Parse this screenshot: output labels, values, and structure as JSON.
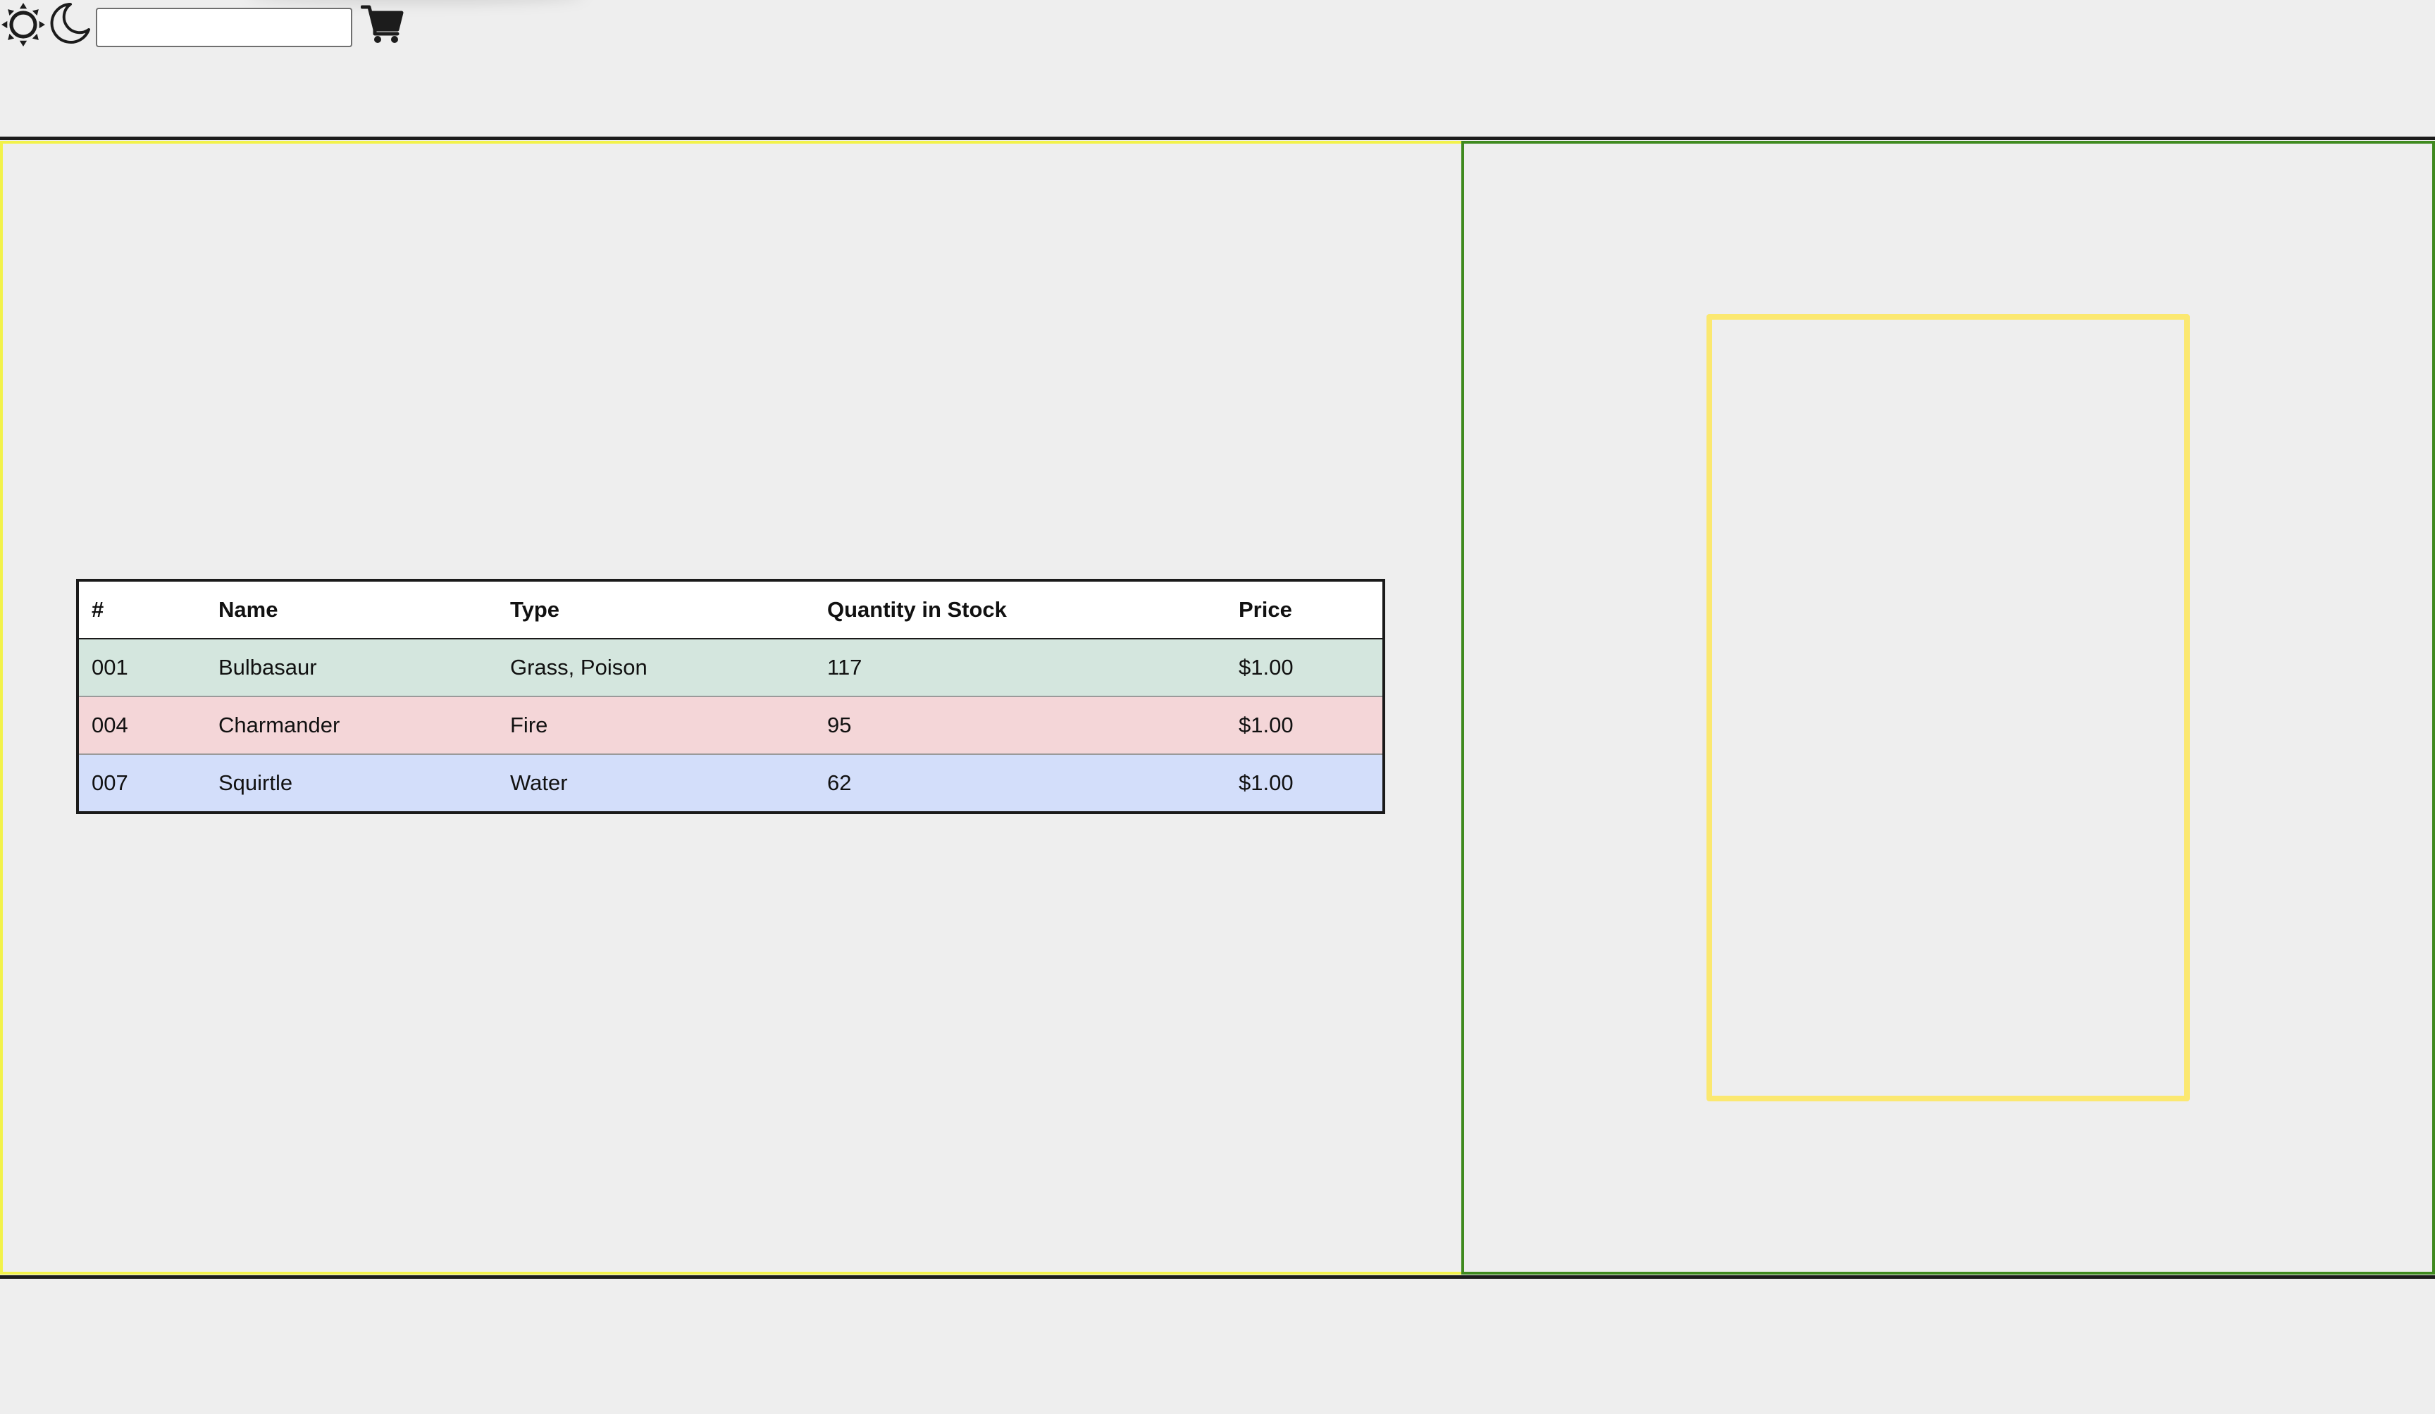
{
  "toolbar": {
    "light_mode_icon": "sun-icon",
    "dark_mode_icon": "moon-icon",
    "search": {
      "value": "",
      "placeholder": ""
    },
    "cart_icon": "cart-icon"
  },
  "inventory": {
    "headers": [
      "#",
      "Name",
      "Type",
      "Quantity in Stock",
      "Price"
    ],
    "rows": [
      {
        "number": "001",
        "name": "Bulbasaur",
        "type": "Grass, Poison",
        "quantity": "117",
        "price": "$1.00",
        "row_color": "#d4e6de"
      },
      {
        "number": "004",
        "name": "Charmander",
        "type": "Fire",
        "quantity": "95",
        "price": "$1.00",
        "row_color": "#f4d6d8"
      },
      {
        "number": "007",
        "name": "Squirtle",
        "type": "Water",
        "quantity": "62",
        "price": "$1.00",
        "row_color": "#d3defa"
      }
    ]
  },
  "colors": {
    "background": "#eeeeee",
    "left_panel_border": "#f2f24a",
    "right_panel_border": "#3f8a1f",
    "card_frame_border": "#fbe870"
  }
}
